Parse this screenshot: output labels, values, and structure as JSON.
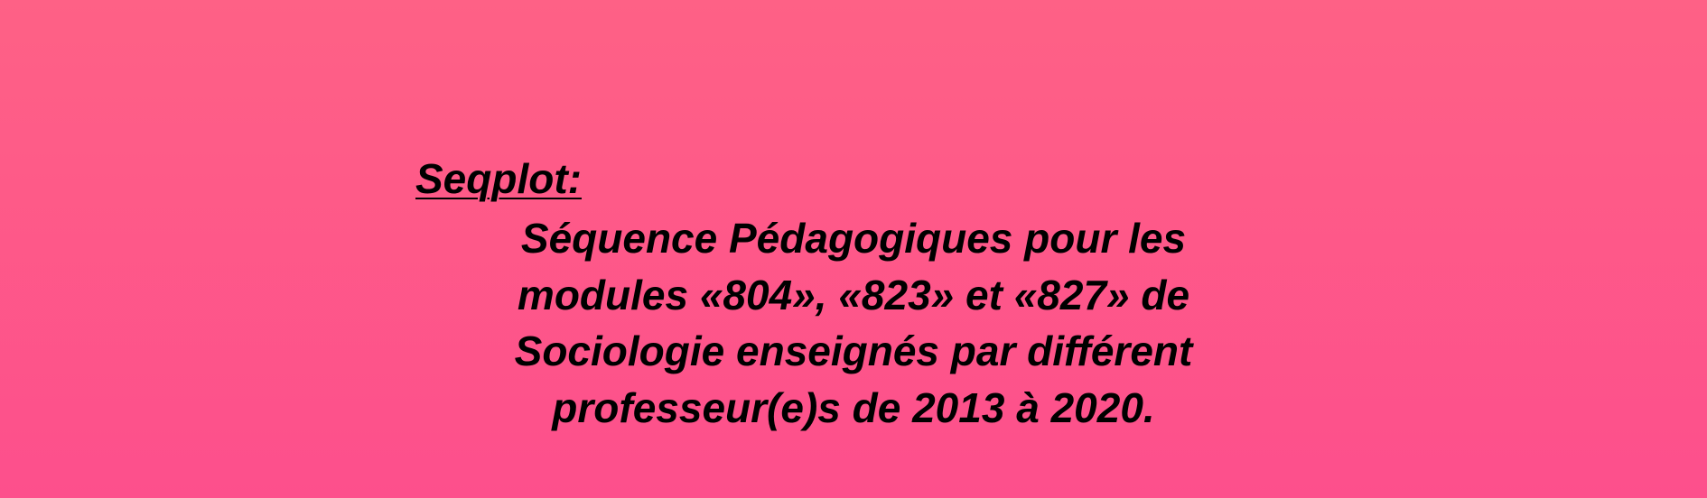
{
  "background": {
    "gradient_top": "#FE6186",
    "gradient_bottom": "#FD4F8C"
  },
  "text_color": "#000000",
  "heading": "Seqplot:",
  "body_lines": [
    "Séquence Pédagogiques pour les",
    "modules «804», «823» et «827» de",
    "Sociologie enseignés par différent",
    "professeur(e)s de 2013 à 2020."
  ]
}
